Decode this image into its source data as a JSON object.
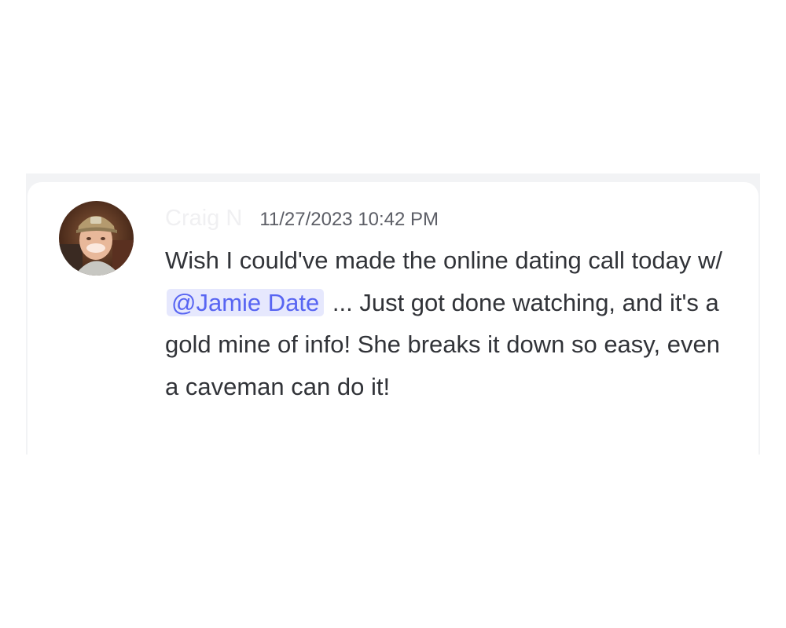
{
  "message": {
    "author": "Craig N",
    "timestamp": "11/27/2023 10:42 PM",
    "text_before_mention": "Wish I could've made the online dating call today w/ ",
    "mention": "@Jamie Date",
    "text_after_mention": " ... Just got done watching, and it's a gold mine of info! She breaks it down so easy, even a caveman can do it!",
    "avatar_icon": "user-avatar-photo"
  },
  "colors": {
    "mention_text": "#5865f2",
    "mention_background": "#e6e8fd",
    "message_text": "#313338",
    "timestamp_text": "#5c5e66",
    "username_text": "#f0f0f2",
    "card_backdrop": "#f2f3f5"
  }
}
